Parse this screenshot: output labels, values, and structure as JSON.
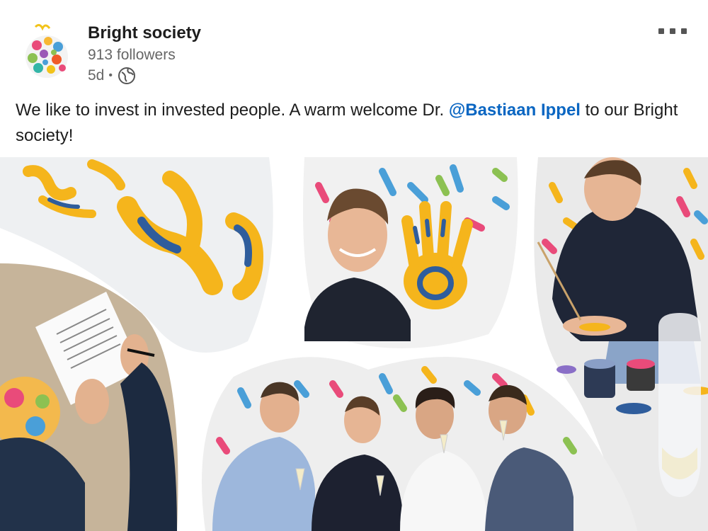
{
  "post": {
    "author": {
      "name": "Bright society",
      "followers": "913 followers",
      "time": "5d",
      "separator": "•",
      "logo_icon": "bright-society-logo",
      "visibility_icon": "globe-icon"
    },
    "menu_icon": "more-options-icon",
    "text": {
      "before": "We like to invest in invested people. A warm welcome Dr. ",
      "mention": "@Bastiaan Ippel",
      "after": " to our Bright society!"
    },
    "image": {
      "description_icon": "photo-collage"
    }
  },
  "colors": {
    "mention": "#0a66c2",
    "name": "#1d1d1d",
    "meta": "#666666",
    "paint_yellow": "#f5b51c",
    "paint_blue": "#2f5d9c"
  }
}
